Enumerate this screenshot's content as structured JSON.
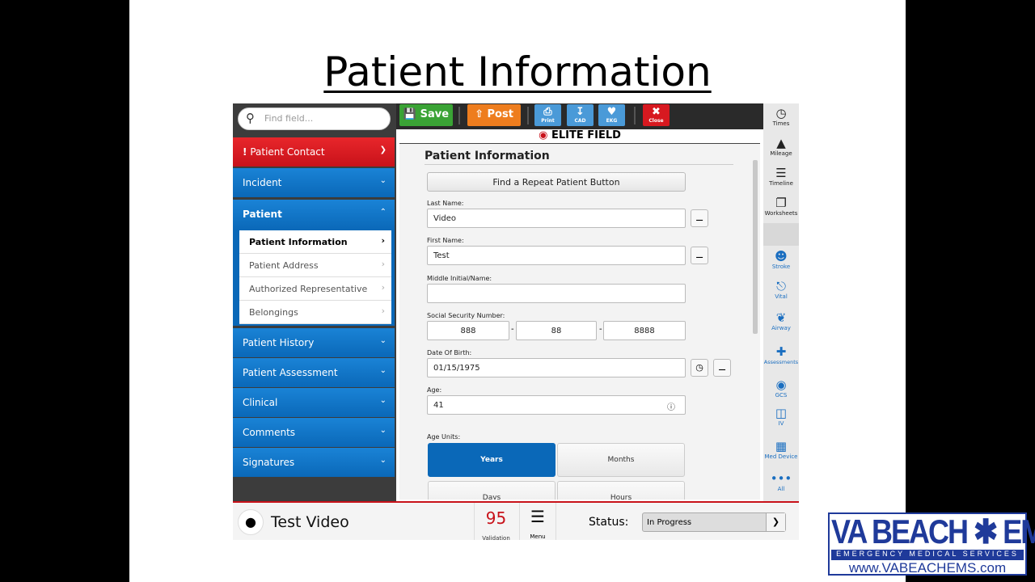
{
  "slide_title": "Patient Information",
  "search": {
    "placeholder": "Find field..."
  },
  "nav": [
    {
      "label": "Patient Contact",
      "alert": "!"
    },
    {
      "label": "Incident"
    },
    {
      "label": "Patient"
    },
    {
      "label": "Patient History"
    },
    {
      "label": "Patient Assessment"
    },
    {
      "label": "Clinical"
    },
    {
      "label": "Comments"
    },
    {
      "label": "Signatures"
    }
  ],
  "subnav": [
    "Patient Information",
    "Patient Address",
    "Authorized Representative",
    "Belongings"
  ],
  "toolbar": {
    "save": "Save",
    "post": "Post",
    "print": "Print",
    "cad": "CAD",
    "ekg": "EKG",
    "close": "Close"
  },
  "brand_header": "ELITE FIELD",
  "form": {
    "title": "Patient Information",
    "repeat_button": "Find a Repeat Patient Button",
    "last_name_label": "Last Name:",
    "last_name": "Video",
    "first_name_label": "First Name:",
    "first_name": "Test",
    "middle_label": "Middle Initial/Name:",
    "middle": "",
    "ssn_label": "Social Security Number:",
    "ssn": [
      "888",
      "88",
      "8888"
    ],
    "ssn_sep": "-",
    "dob_label": "Date Of Birth:",
    "dob": "01/15/1975",
    "age_label": "Age:",
    "age": "41",
    "age_units_label": "Age Units:",
    "age_units": [
      "Years",
      "Months",
      "Days",
      "Hours"
    ],
    "age_unit_selected": "Years"
  },
  "rail": [
    "Times",
    "Mileage",
    "Timeline",
    "Worksheets",
    "Stroke",
    "Vital",
    "Airway",
    "Assessments",
    "GCS",
    "IV",
    "Med Device",
    "All"
  ],
  "bottom": {
    "patient_name": "Test Video",
    "validation_count": "95",
    "validation_label": "Validation",
    "menu_label": "Menu",
    "status_label": "Status:",
    "status_value": "In Progress"
  },
  "logo": {
    "line1": "VA BEACH EMS",
    "line2": "EMERGENCY MEDICAL SERVICES",
    "url": "www.VABEACHEMS.com"
  },
  "colors": {
    "accent_blue": "#0a68b8",
    "alert_red": "#c8121a",
    "save_green": "#3aa335",
    "post_orange": "#ee7d1e"
  }
}
